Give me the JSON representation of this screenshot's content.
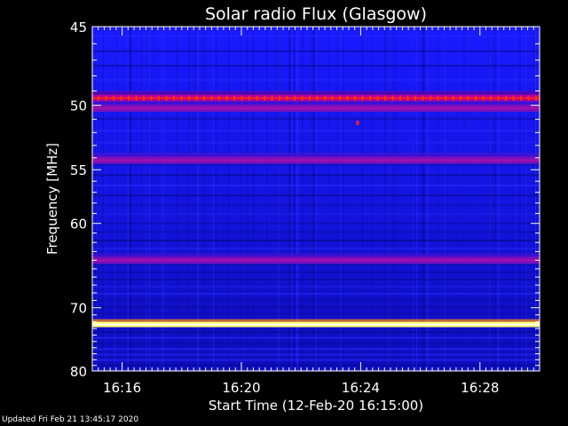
{
  "chart_data": {
    "type": "heatmap",
    "title": "Solar radio Flux (Glasgow)",
    "xlabel": "Start Time (12-Feb-20 16:15:00)",
    "ylabel": "Frequency [MHz]",
    "x_tick_labels": [
      "16:16",
      "16:20",
      "16:24",
      "16:28"
    ],
    "x_tick_minutes": [
      16,
      20,
      24,
      28
    ],
    "xlim_minutes": [
      15.0,
      30.0
    ],
    "y_tick_labels": [
      "45",
      "50",
      "55",
      "60",
      "70",
      "80"
    ],
    "y_tick_values": [
      45,
      50,
      55,
      60,
      70,
      80
    ],
    "yaxis_scale": "reciprocal",
    "ylim": [
      45,
      80
    ],
    "background_level": 0.35,
    "bands": [
      {
        "freq": 49.5,
        "intensity": 0.6,
        "pattern": "periodic spikes"
      },
      {
        "freq": 50.2,
        "intensity": 0.55
      },
      {
        "freq": 54.2,
        "intensity": 0.5
      },
      {
        "freq": 64.0,
        "intensity": 0.55
      },
      {
        "freq": 72.4,
        "intensity": 1.0
      }
    ],
    "colormap": [
      "#000000",
      "#0000aa",
      "#2222ff",
      "#aa00aa",
      "#ff0000",
      "#ffff00",
      "#ffffff"
    ],
    "grid": false
  },
  "footer": {
    "updated_text": "Updated Fri Feb 21 13:45:17 2020"
  }
}
